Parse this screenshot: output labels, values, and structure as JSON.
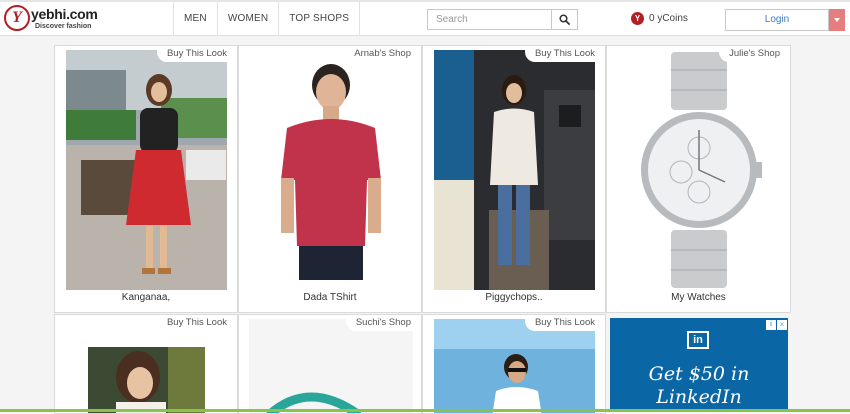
{
  "brand": {
    "logo_letter": "Y",
    "name": "yebhi.com",
    "tagline": "Discover fashion"
  },
  "nav": {
    "items": [
      "MEN",
      "WOMEN",
      "TOP SHOPS"
    ]
  },
  "search": {
    "placeholder": "Search",
    "value": "",
    "icon": "magnifier-icon"
  },
  "coins": {
    "icon_letter": "Y",
    "label": "0 yCoins"
  },
  "login": {
    "label": "Login",
    "dropdown_icon": "caret-down-icon"
  },
  "cards": [
    {
      "shop": "Buy This Look",
      "caption": "Kanganaa,",
      "image": "woman in black top and red skirt"
    },
    {
      "shop": "Arnab's Shop",
      "caption": "Dada TShirt",
      "image": "man in red polo t-shirt"
    },
    {
      "shop": "Buy This Look",
      "caption": "Piggychops..",
      "image": "woman in white lace top and jeans"
    },
    {
      "shop": "Julie's Shop",
      "caption": "My Watches",
      "image": "silver chronograph watch"
    },
    {
      "shop": "Buy This Look",
      "caption": "",
      "image": "woman portrait"
    },
    {
      "shop": "Suchi's Shop",
      "caption": "",
      "image": "green bangle"
    },
    {
      "shop": "Buy This Look",
      "caption": "",
      "image": "man outdoors with sunglasses"
    }
  ],
  "ad": {
    "logo": "in",
    "headline_line1": "Get $50 in",
    "headline_line2": "LinkedIn",
    "info_icon": "i",
    "close_icon": "×"
  },
  "colors": {
    "brand_red": "#b21f24",
    "login_text": "#3a7bbf",
    "dropdown_bg": "#e57f7f",
    "ad_blue": "#0a66a4"
  }
}
